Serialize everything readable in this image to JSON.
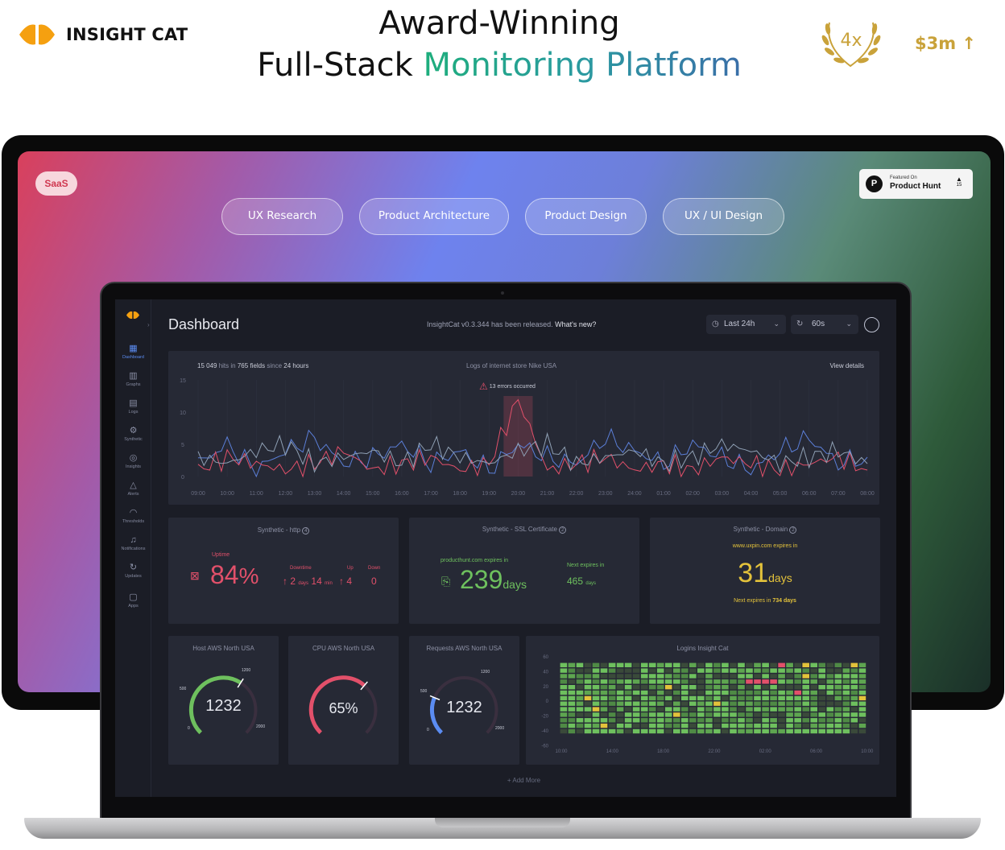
{
  "brand": {
    "name": "INSIGHT CAT"
  },
  "headline": {
    "line1": "Award-Winning",
    "line2_plain": "Full-Stack ",
    "line2_accent": "Monitoring Platform"
  },
  "award": {
    "text": "4x"
  },
  "funding": {
    "text": "$3m ↑"
  },
  "colors": {
    "accent_gold": "#c9a23a",
    "brand_orange": "#f5a010",
    "good": "#6ec05e",
    "bad": "#e2506a",
    "warn": "#e3c23b",
    "blue": "#5b8cf2"
  },
  "banner": {
    "badge": "SaaS",
    "pills": [
      "UX Research",
      "Product Architecture",
      "Product Design",
      "UX / UI Design"
    ],
    "product_hunt": {
      "small": "Featured On",
      "big": "Product Hunt",
      "votes": "15"
    }
  },
  "app": {
    "title": "Dashboard",
    "release": "InsightCat v0.3.344 has been released.",
    "release_link": "What's new?",
    "time_range": "Last 24h",
    "refresh": "60s",
    "nav": [
      {
        "label": "Dashboard",
        "icon": "dashboard-icon"
      },
      {
        "label": "Graphs",
        "icon": "graphs-icon"
      },
      {
        "label": "Logs",
        "icon": "logs-icon"
      },
      {
        "label": "Synthetic",
        "icon": "synthetic-icon"
      },
      {
        "label": "Insights",
        "icon": "insights-icon"
      },
      {
        "label": "Alerts",
        "icon": "alerts-icon"
      },
      {
        "label": "Thresholds",
        "icon": "thresholds-icon"
      },
      {
        "label": "Notifications",
        "icon": "notifications-icon"
      },
      {
        "label": "Updates",
        "icon": "updates-icon"
      },
      {
        "label": "Apps",
        "icon": "apps-icon"
      }
    ],
    "logs": {
      "hits": "15 049",
      "hits_label": "hits in",
      "fields": "765",
      "fields_label": "fields",
      "since_label": "since",
      "since": "24 hours",
      "title": "Logs of internet store Nike USA",
      "view_details": "View details",
      "errors": "13 errors occurred"
    },
    "synthetic_http": {
      "title": "Synthetic - http",
      "info": "4",
      "uptime_label": "Uptime",
      "uptime": "84",
      "unit": "%",
      "downtime_label": "Downtime",
      "up_label": "Up",
      "down_label": "Down",
      "downtime_days": "2",
      "days_word": "days",
      "downtime_min": "14",
      "min_word": "min",
      "up": "4",
      "down": "0"
    },
    "synthetic_ssl": {
      "title": "Synthetic - SSL Certificate",
      "info": "2",
      "expires_label": "producthunt.com expires in",
      "value": "239",
      "unit": "days",
      "next_label": "Next expires in",
      "next_value": "465",
      "next_unit": "days"
    },
    "synthetic_domain": {
      "title": "Synthetic - Domain",
      "info": "2",
      "expires_label": "www.uxpin.com expires in",
      "value": "31",
      "unit": "days",
      "next_label": "Next expires in",
      "next_value": "734 days"
    },
    "gauges": [
      {
        "title": "Host AWS North USA",
        "value": "1232",
        "fraction": 0.62,
        "color": "#6ec05e",
        "labels": [
          "0",
          "500",
          "1200",
          "2000"
        ]
      },
      {
        "title": "CPU AWS North USA",
        "value": "65%",
        "fraction": 0.65,
        "color": "#e2506a",
        "labels": []
      },
      {
        "title": "Requests AWS North USA",
        "value": "1232",
        "fraction": 0.25,
        "color": "#5b8cf2",
        "labels": [
          "0",
          "500",
          "1200",
          "2000"
        ]
      }
    ],
    "logins": {
      "title": "Logins Insight Cat"
    },
    "add_more": "+ Add More"
  },
  "chart_data": [
    {
      "type": "line",
      "title": "Logs of internet store Nike USA",
      "categories": [
        "09:00",
        "10:00",
        "11:00",
        "12:00",
        "13:00",
        "14:00",
        "15:00",
        "16:00",
        "17:00",
        "18:00",
        "19:00",
        "20:00",
        "21:00",
        "22:00",
        "23:00",
        "24:00",
        "01:00",
        "02:00",
        "03:00",
        "04:00",
        "05:00",
        "06:00",
        "07:00",
        "08:00"
      ],
      "yticks": [
        "0",
        "5",
        "10",
        "15"
      ],
      "ylim": [
        0,
        15
      ],
      "series": [
        {
          "color": "#5b7fd8",
          "values": [
            2,
            5,
            1,
            4,
            6,
            2,
            3,
            5,
            2,
            4,
            1,
            5,
            3,
            2,
            6,
            4,
            2,
            5,
            3,
            1,
            4,
            6,
            2,
            3
          ]
        },
        {
          "color": "#e2506a",
          "values": [
            1,
            3,
            2,
            1,
            2,
            4,
            1,
            2,
            3,
            1,
            2,
            12,
            1,
            2,
            3,
            1,
            2,
            1,
            3,
            2,
            1,
            2,
            3,
            1
          ]
        },
        {
          "color": "#8fa0b4",
          "values": [
            3,
            2,
            4,
            5,
            2,
            3,
            4,
            2,
            5,
            3,
            2,
            4,
            5,
            2,
            3,
            4,
            2,
            3,
            5,
            4,
            2,
            3,
            4,
            2
          ]
        }
      ]
    },
    {
      "type": "heatmap",
      "title": "Logins Insight Cat",
      "xticks": [
        "10:00",
        "14:00",
        "18:00",
        "22:00",
        "02:00",
        "06:00",
        "10:00"
      ],
      "yticks": [
        "60",
        "40",
        "20",
        "0",
        "-20",
        "-40",
        "-60"
      ]
    }
  ]
}
